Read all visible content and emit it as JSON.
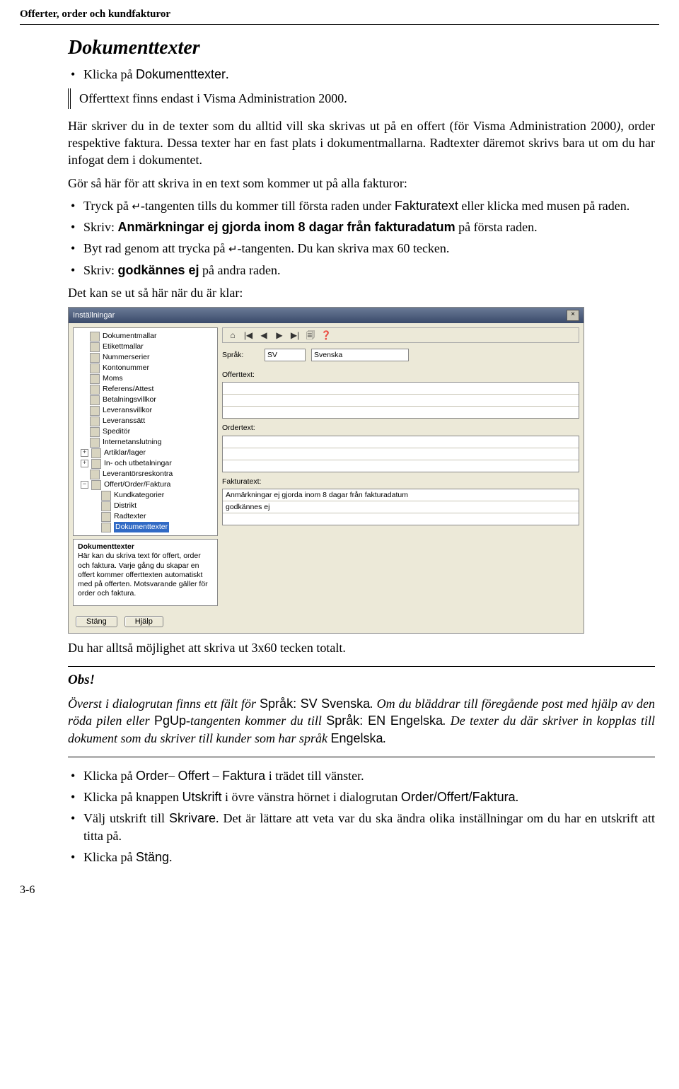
{
  "header": "Offerter, order och kundfakturor",
  "title": "Dokumenttexter",
  "bullet_intro": "Klicka på ",
  "bullet_intro_sans": "Dokumenttexter",
  "bullet_intro_end": ".",
  "callout": "Offerttext finns endast i Visma Administration 2000.",
  "para1_a": "Här skriver du in de texter som du alltid vill ska skrivas ut på en offert (för Visma Administration 2000",
  "para1_b": ")",
  "para1_c": ", order respektive faktura. Dessa texter har en fast plats i dokumentmallarna. Radtexter däremot skrivs bara ut om du har infogat dem i dokumentet.",
  "para2": "Gör så här för att skriva in en text som kommer ut på alla fakturor:",
  "b1_a": "Tryck på ",
  "b1_key": "↵",
  "b1_b": "-tangenten tills du kommer till första raden under ",
  "b1_sans": "Fakturatext",
  "b1_c": " eller klicka med musen på raden.",
  "b2_a": "Skriv: ",
  "b2_bold": "Anmärkningar ej gjorda inom 8 dagar från fakturadatum",
  "b2_b": " på första raden.",
  "b3_a": "Byt rad genom att trycka på ",
  "b3_key": "↵",
  "b3_b": "-tangenten. Du kan skriva max 60 tecken.",
  "b4_a": "Skriv: ",
  "b4_bold": "godkännes ej",
  "b4_b": " på andra raden.",
  "para3": "Det kan se ut så här när du är klar:",
  "dialog": {
    "title": "Inställningar",
    "close_glyph": "×",
    "tree": [
      "Dokumentmallar",
      "Etikettmallar",
      "Nummerserier",
      "Kontonummer",
      "Moms",
      "Referens/Attest",
      "Betalningsvillkor",
      "Leveransvillkor",
      "Leveranssätt",
      "Speditör",
      "Internetanslutning"
    ],
    "tree_exp": [
      {
        "toggle": "+",
        "label": "Artiklar/lager"
      },
      {
        "toggle": "+",
        "label": "In- och utbetalningar"
      },
      {
        "toggle": "",
        "label": "Leverantörsreskontra"
      },
      {
        "toggle": "−",
        "label": "Offert/Order/Faktura"
      }
    ],
    "tree_sub": [
      "Kundkategorier",
      "Distrikt",
      "Radtexter",
      "Dokumenttexter"
    ],
    "desc_title": "Dokumenttexter",
    "desc_body": "Här kan du skriva text för offert, order och faktura. Varje gång du skapar en offert kommer offerttexten automatiskt med på offerten. Motsvarande gäller för order och faktura.",
    "toolbar_icons": [
      "⌂",
      "|◀",
      "◀",
      "▶",
      "▶|",
      "🗐",
      "❓"
    ],
    "lang_label": "Språk:",
    "lang_code": "SV",
    "lang_name": "Svenska",
    "offert_label": "Offerttext:",
    "order_label": "Ordertext:",
    "faktura_label": "Fakturatext:",
    "faktura_rows": [
      "Anmärkningar ej gjorda inom 8 dagar från fakturadatum",
      "godkännes ej",
      ""
    ],
    "btn_close": "Stäng",
    "btn_help": "Hjälp"
  },
  "after_fig": "Du har alltså möjlighet att skriva ut 3x60 tecken totalt.",
  "obs_head": "Obs!",
  "obs_a": "Överst i dialogrutan finns ett fält för ",
  "obs_sans1": "Språk: SV Svenska",
  "obs_b": ". Om du bläddrar till föregående post med hjälp av den röda pilen eller ",
  "obs_sans2": "PgUp",
  "obs_c": "-tangenten kommer du till ",
  "obs_sans3": "Språk: EN Engelska",
  "obs_d": ". De texter du där skriver in kopplas till dokument som du skriver till kunder som har språk ",
  "obs_sans4": "Engelska",
  "obs_e": ".",
  "end1_a": "Klicka på ",
  "end1_s1": "Order",
  "end1_b": "– ",
  "end1_s2": "Offert",
  "end1_c": " – ",
  "end1_s3": "Faktura",
  "end1_d": " i trädet till vänster.",
  "end2_a": "Klicka på knappen ",
  "end2_s1": "Utskrift",
  "end2_b": " i övre vänstra hörnet i dialogrutan ",
  "end2_s2": "Order/Offert/Faktura",
  "end2_c": ".",
  "end3_a": "Välj utskrift till ",
  "end3_s1": "Skrivare",
  "end3_b": ". Det är lättare att veta var du ska ändra olika inställningar om du har en utskrift att titta på.",
  "end4_a": "Klicka på ",
  "end4_s1": "Stäng",
  "end4_b": ".",
  "page_number": "3-6"
}
